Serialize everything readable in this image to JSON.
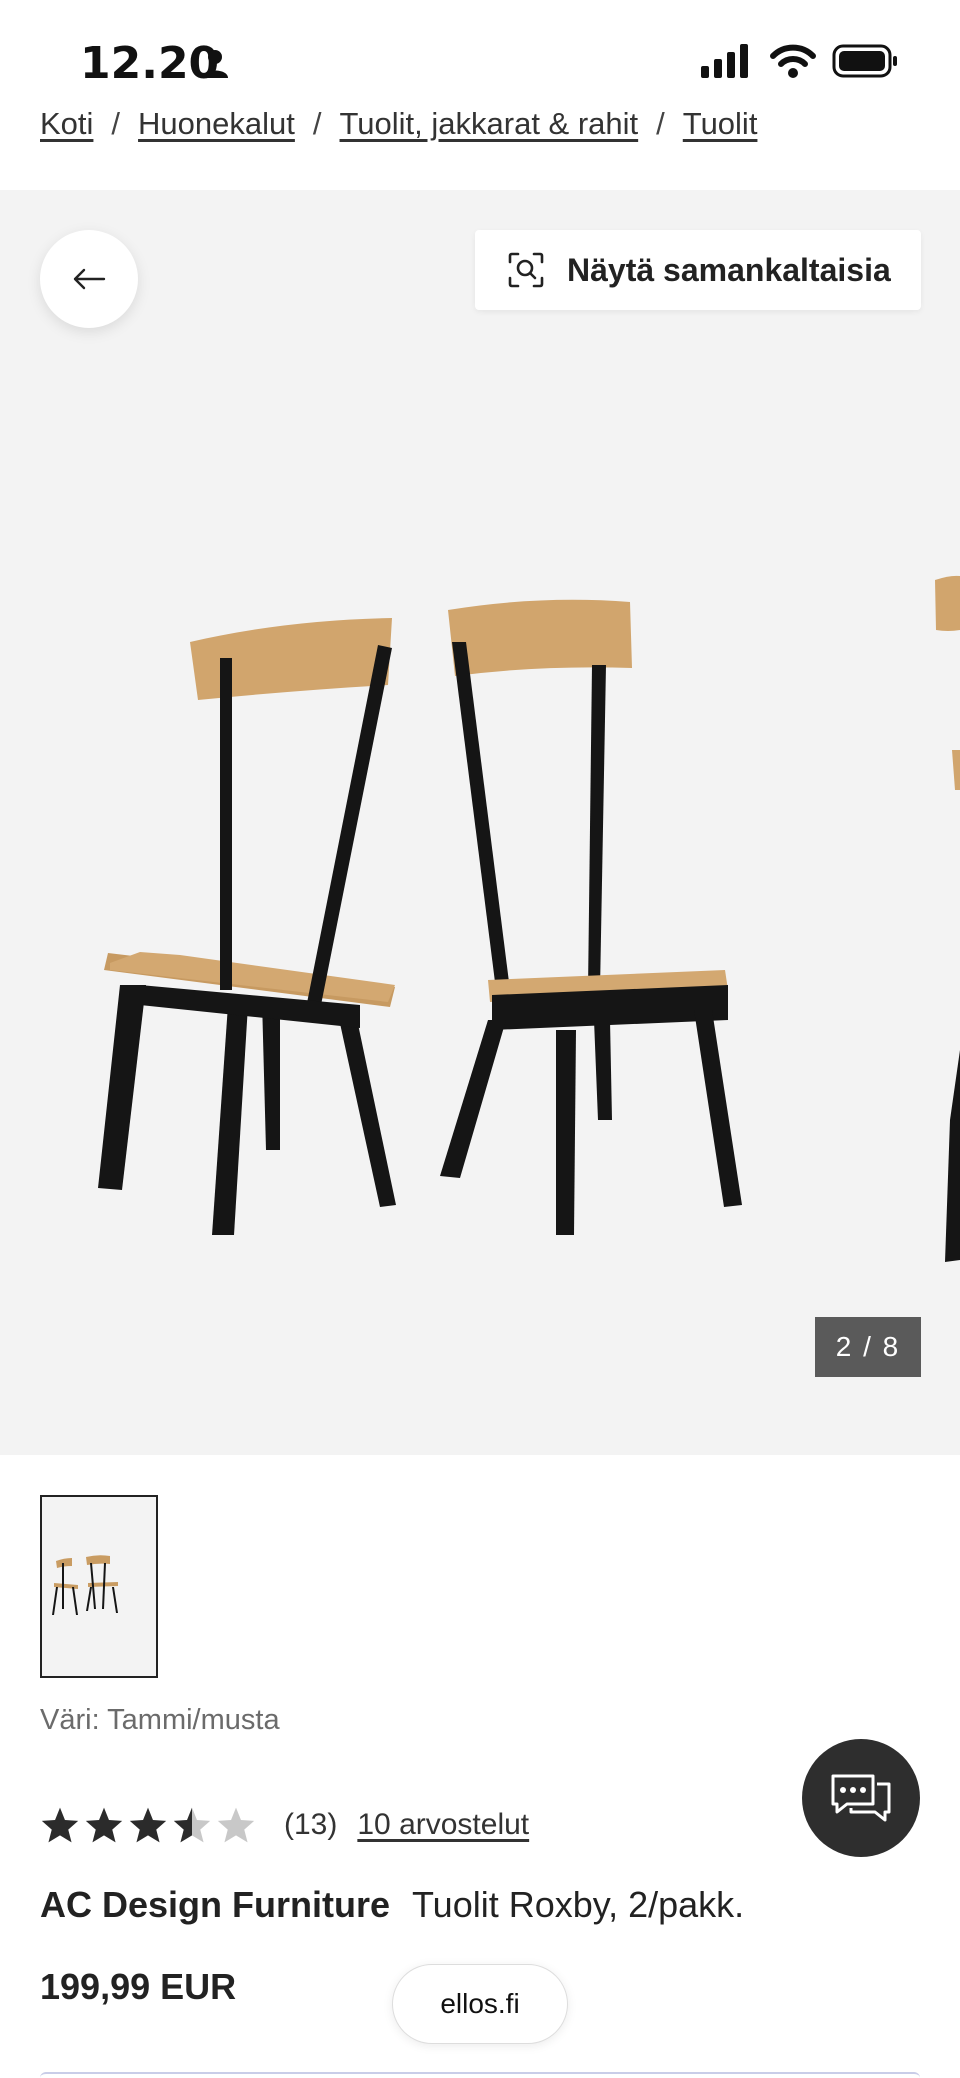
{
  "status_bar": {
    "time": "12.20"
  },
  "breadcrumb": [
    {
      "label": "Koti"
    },
    {
      "label": "Huonekalut"
    },
    {
      "label": "Tuolit, jakkarat & rahit"
    },
    {
      "label": "Tuolit"
    }
  ],
  "gallery": {
    "similar_label": "Näytä samankaltaisia",
    "counter": "2 / 8",
    "current_image": 2,
    "total_images": 8
  },
  "product": {
    "color_label": "Väri: Tammi/musta",
    "rating_value": 3.5,
    "rating_max": 5,
    "rating_count": "(13)",
    "reviews_link": "10 arvostelut",
    "brand": "AC Design Furniture",
    "name": "Tuolit Roxby, 2/pakk.",
    "price": "199,99 EUR"
  },
  "site_pill": "ellos.fi",
  "icons": {
    "back": "arrow-left-icon",
    "similar": "visual-search-icon",
    "chat": "chat-bubbles-icon",
    "person": "person-icon",
    "signal": "signal-icon",
    "wifi": "wifi-icon",
    "battery": "battery-icon"
  }
}
